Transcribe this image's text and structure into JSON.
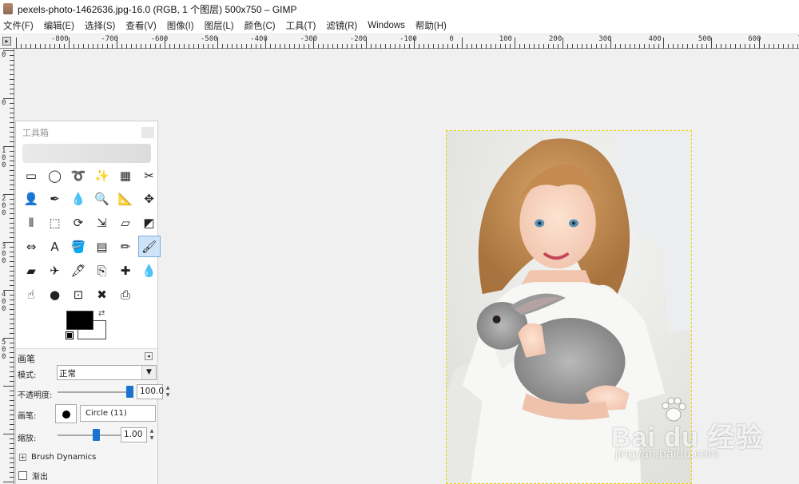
{
  "window": {
    "title": "pexels-photo-1462636.jpg-16.0 (RGB, 1 个图层) 500x750 – GIMP"
  },
  "menubar": {
    "items": [
      "文件(F)",
      "编辑(E)",
      "选择(S)",
      "查看(V)",
      "图像(I)",
      "图层(L)",
      "颜色(C)",
      "工具(T)",
      "滤镜(R)",
      "Windows",
      "帮助(H)"
    ]
  },
  "ruler_top": {
    "labels": [
      "-800",
      "-700",
      "-600",
      "-500",
      "-400",
      "-300",
      "-200",
      "-100",
      "0",
      "100",
      "200",
      "300",
      "400",
      "500",
      "600",
      "700"
    ],
    "corner_icon": "navigate-icon"
  },
  "ruler_left": {
    "labels": [
      "0",
      "0",
      "1 0 0",
      "2 0 0",
      "3 0 0",
      "4 0 0",
      "5 0 0"
    ]
  },
  "toolbox": {
    "title": "工具箱",
    "tools": [
      {
        "name": "rect-select-tool",
        "glyph": "▭"
      },
      {
        "name": "ellipse-select-tool",
        "glyph": "◯"
      },
      {
        "name": "free-select-tool",
        "glyph": "➰"
      },
      {
        "name": "fuzzy-select-tool",
        "glyph": "✨"
      },
      {
        "name": "color-select-tool",
        "glyph": "▦"
      },
      {
        "name": "scissors-select-tool",
        "glyph": "✂"
      },
      {
        "name": "foreground-select-tool",
        "glyph": "👤"
      },
      {
        "name": "paths-tool",
        "glyph": "✒"
      },
      {
        "name": "color-picker-tool",
        "glyph": "💧"
      },
      {
        "name": "zoom-tool",
        "glyph": "🔍"
      },
      {
        "name": "measure-tool",
        "glyph": "📐"
      },
      {
        "name": "move-tool",
        "glyph": "✥"
      },
      {
        "name": "align-tool",
        "glyph": "⫴"
      },
      {
        "name": "crop-tool",
        "glyph": "⬚"
      },
      {
        "name": "rotate-tool",
        "glyph": "⟳"
      },
      {
        "name": "scale-tool",
        "glyph": "⇲"
      },
      {
        "name": "shear-tool",
        "glyph": "▱"
      },
      {
        "name": "perspective-tool",
        "glyph": "◩"
      },
      {
        "name": "flip-tool",
        "glyph": "⇔"
      },
      {
        "name": "text-tool",
        "glyph": "A"
      },
      {
        "name": "bucket-fill-tool",
        "glyph": "🪣"
      },
      {
        "name": "blend-tool",
        "glyph": "▤"
      },
      {
        "name": "pencil-tool",
        "glyph": "✏"
      },
      {
        "name": "paintbrush-tool",
        "glyph": "🖌"
      },
      {
        "name": "eraser-tool",
        "glyph": "▰"
      },
      {
        "name": "airbrush-tool",
        "glyph": "✈"
      },
      {
        "name": "ink-tool",
        "glyph": "🖋"
      },
      {
        "name": "clone-tool",
        "glyph": "⎘"
      },
      {
        "name": "heal-tool",
        "glyph": "✚"
      },
      {
        "name": "blur-sharpen-tool",
        "glyph": "💧"
      },
      {
        "name": "smudge-tool",
        "glyph": "☝"
      },
      {
        "name": "dodge-burn-tool",
        "glyph": "●"
      },
      {
        "name": "cage-transform-tool",
        "glyph": "⊡"
      },
      {
        "name": "warp-transform-tool",
        "glyph": "✖"
      },
      {
        "name": "perspective-clone-tool",
        "glyph": "⎙"
      }
    ],
    "active_tool": "paintbrush-tool",
    "foreground_color": "#000000",
    "background_color": "#ffffff"
  },
  "tool_options": {
    "title": "画笔",
    "mode_label": "模式:",
    "mode_value": "正常",
    "opacity_label": "不透明度:",
    "opacity_value": "100.0",
    "opacity_fraction": 1.0,
    "brush_label": "画笔:",
    "brush_value": "Circle (11)",
    "scale_label": "缩放:",
    "scale_value": "1.00",
    "brush_dynamics_label": "Brush Dynamics",
    "fade_label": "渐出"
  },
  "canvas": {
    "image_description_icon": "photo-girl-with-rabbit",
    "selection_border_color": "#e6d800"
  },
  "watermark": {
    "brand": "Bai du 经验",
    "url": "jingyan.baidu.com"
  }
}
